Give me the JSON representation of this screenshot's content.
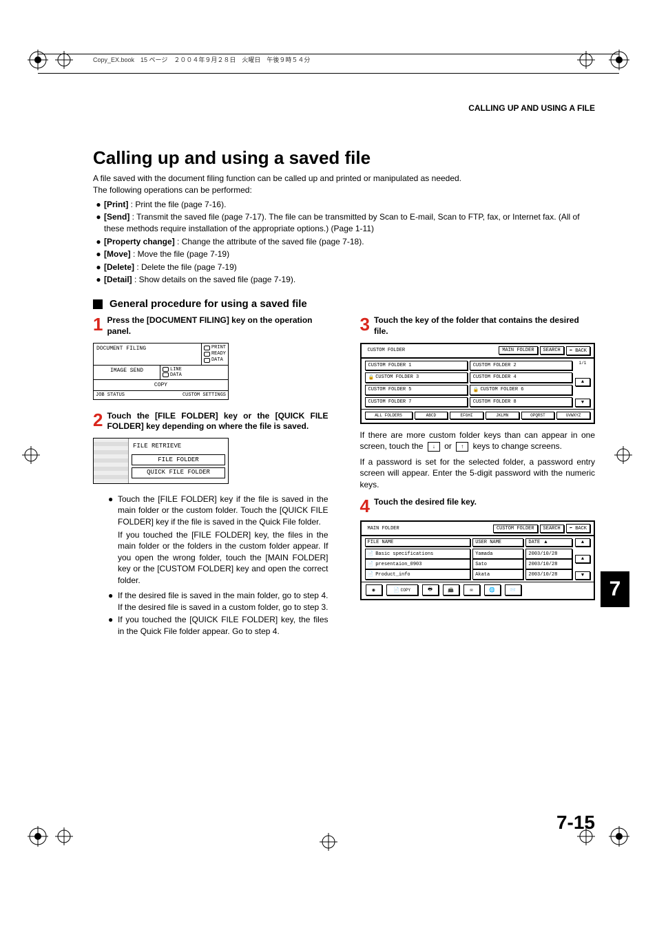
{
  "book_header": "Copy_EX.book　15 ページ　２００４年９月２８日　火曜日　午後９時５４分",
  "running_head": "CALLING UP AND USING A FILE",
  "h1": "Calling up and using a saved file",
  "intro_line1": "A file saved with the document filing function can be called up and printed or manipulated as needed.",
  "intro_line2": "The following operations can be performed:",
  "ops": [
    {
      "label": "[Print]",
      "desc": " : Print the file (page 7-16)."
    },
    {
      "label": "[Send]",
      "desc": " : Transmit the saved file (page 7-17). The file can be transmitted by Scan to E-mail, Scan to FTP, fax, or Internet fax. (All of these methods require installation of the appropriate options.) (Page 1-11)"
    },
    {
      "label": "[Property change]",
      "desc": " : Change the attribute of the saved file (page 7-18)."
    },
    {
      "label": "[Move]",
      "desc": " : Move the file (page 7-19)"
    },
    {
      "label": "[Delete]",
      "desc": " : Delete the file (page 7-19)"
    },
    {
      "label": "[Detail]",
      "desc": " : Show details on the saved file (page 7-19)."
    }
  ],
  "subhead": "General procedure for using a saved file",
  "step1_title": "Press the [DOCUMENT FILING] key on the operation panel.",
  "doc_filing_panel": {
    "title": "DOCUMENT FILING",
    "leds": [
      "PRINT",
      "READY",
      "DATA"
    ],
    "mid_left": "IMAGE SEND",
    "mid_right": [
      "LINE",
      "DATA"
    ],
    "copy": "COPY",
    "job_status": "JOB STATUS",
    "custom": "CUSTOM SETTINGS"
  },
  "step2_title": "Touch the [FILE FOLDER] key or the [QUICK FILE FOLDER] key depending on where the file is saved.",
  "retrieve": {
    "title": "FILE RETRIEVE",
    "btn1": "FILE FOLDER",
    "btn2": "QUICK FILE FOLDER"
  },
  "step2_bullets": [
    "Touch the [FILE FOLDER] key if the file is saved in the main folder or the custom folder. Touch the [QUICK FILE FOLDER] key if the file is saved in the Quick File folder.",
    "If you touched the [FILE FOLDER] key, the files in the main folder or the folders in the custom folder appear. If you open the wrong folder, touch the [MAIN FOLDER] key or the [CUSTOM FOLDER] key and open the correct folder.",
    "If the desired file is saved in the main folder, go to step 4. If the desired file is saved in a custom folder, go to step 3.",
    "If you touched the [QUICK FILE FOLDER] key, the files in the Quick File folder appear. Go to step 4."
  ],
  "step2_continuation_index": 1,
  "step3_title": "Touch the key of the folder that contains the desired file.",
  "custom_screen": {
    "header_label": "CUSTOM FOLDER",
    "header_buttons": [
      "MAIN FOLDER",
      "SEARCH",
      "BACK"
    ],
    "folders": [
      "CUSTOM FOLDER 1",
      "CUSTOM FOLDER 2",
      "CUSTOM FOLDER 3",
      "CUSTOM FOLDER 4",
      "CUSTOM FOLDER 5",
      "CUSTOM FOLDER 6",
      "CUSTOM FOLDER 7",
      "CUSTOM FOLDER 8"
    ],
    "page": "1/1",
    "tabs": [
      "ALL FOLDERS",
      "ABCD",
      "EFGHI",
      "JKLMN",
      "OPQRST",
      "UVWXYZ"
    ]
  },
  "step3_para1a": "If there are more custom folder keys than can appear in one screen, touch the ",
  "step3_para1b": " or ",
  "step3_para1c": " keys to change screens.",
  "step3_para2": "If a password is set for the selected folder, a password entry screen will appear. Enter the 5-digit password with the numeric keys.",
  "step4_title": "Touch the desired file key.",
  "file_screen": {
    "header_label": "MAIN FOLDER",
    "header_buttons": [
      "CUSTOM FOLDER",
      "SEARCH",
      "BACK"
    ],
    "cols": [
      "FILE NAME",
      "USER NAME",
      "DATE"
    ],
    "rows": [
      {
        "fn": "Basic specifications",
        "un": "Yamada",
        "dt": "2003/10/28"
      },
      {
        "fn": "presentaion_0903",
        "un": "Sato",
        "dt": "2003/10/28"
      },
      {
        "fn": "Product_info",
        "un": "Akata",
        "dt": "2003/10/28"
      }
    ],
    "copy_label": "COPY"
  },
  "tab_number": "7",
  "page_number": "7-15"
}
